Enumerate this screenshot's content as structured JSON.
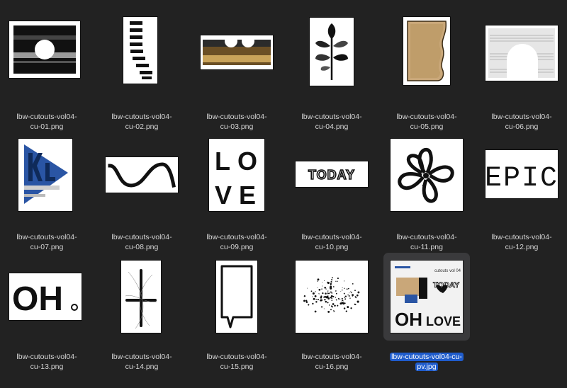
{
  "files": [
    {
      "line1": "lbw-cutouts-vol04-",
      "line2": "cu-01.png",
      "icon": "cutout-circle-thumbnail"
    },
    {
      "line1": "lbw-cutouts-vol04-",
      "line2": "cu-02.png",
      "icon": "cutout-stripes-thumbnail"
    },
    {
      "line1": "lbw-cutouts-vol04-",
      "line2": "cu-03.png",
      "icon": "cutout-scallop-thumbnail"
    },
    {
      "line1": "lbw-cutouts-vol04-",
      "line2": "cu-04.png",
      "icon": "cutout-leaf-thumbnail"
    },
    {
      "line1": "lbw-cutouts-vol04-",
      "line2": "cu-05.png",
      "icon": "cutout-kraft-thumbnail"
    },
    {
      "line1": "lbw-cutouts-vol04-",
      "line2": "cu-06.png",
      "icon": "cutout-arch-thumbnail"
    },
    {
      "line1": "lbw-cutouts-vol04-",
      "line2": "cu-07.png",
      "icon": "cutout-flag-thumbnail"
    },
    {
      "line1": "lbw-cutouts-vol04-",
      "line2": "cu-08.png",
      "icon": "cutout-wave-thumbnail"
    },
    {
      "line1": "lbw-cutouts-vol04-",
      "line2": "cu-09.png",
      "icon": "cutout-love-thumbnail",
      "text": [
        "L",
        "O",
        "V",
        "E"
      ]
    },
    {
      "line1": "lbw-cutouts-vol04-",
      "line2": "cu-10.png",
      "icon": "cutout-today-thumbnail",
      "text": "TODAY"
    },
    {
      "line1": "lbw-cutouts-vol04-",
      "line2": "cu-11.png",
      "icon": "cutout-flower-thumbnail"
    },
    {
      "line1": "lbw-cutouts-vol04-",
      "line2": "cu-12.png",
      "icon": "cutout-epic-thumbnail",
      "text": "EPIC"
    },
    {
      "line1": "lbw-cutouts-vol04-",
      "line2": "cu-13.png",
      "icon": "cutout-oh-thumbnail",
      "text": "OH"
    },
    {
      "line1": "lbw-cutouts-vol04-",
      "line2": "cu-14.png",
      "icon": "cutout-cross-thumbnail"
    },
    {
      "line1": "lbw-cutouts-vol04-",
      "line2": "cu-15.png",
      "icon": "cutout-speech-bubble-thumbnail"
    },
    {
      "line1": "lbw-cutouts-vol04-",
      "line2": "cu-16.png",
      "icon": "cutout-splatter-thumbnail"
    },
    {
      "line1": "lbw-cutouts-vol04-cu-",
      "line2": "pv.jpg",
      "icon": "preview-collage-thumbnail",
      "selected": true,
      "text": {
        "top": "cutouts vol 04",
        "today": "TODAY",
        "oh": "OH",
        "love": "LOVE"
      }
    }
  ],
  "colors": {
    "background": "#222222",
    "selection": "#1f5ccc",
    "label": "#d6d6d6",
    "accent_blue": "#2a55a4",
    "kraft": "#c9a779"
  }
}
